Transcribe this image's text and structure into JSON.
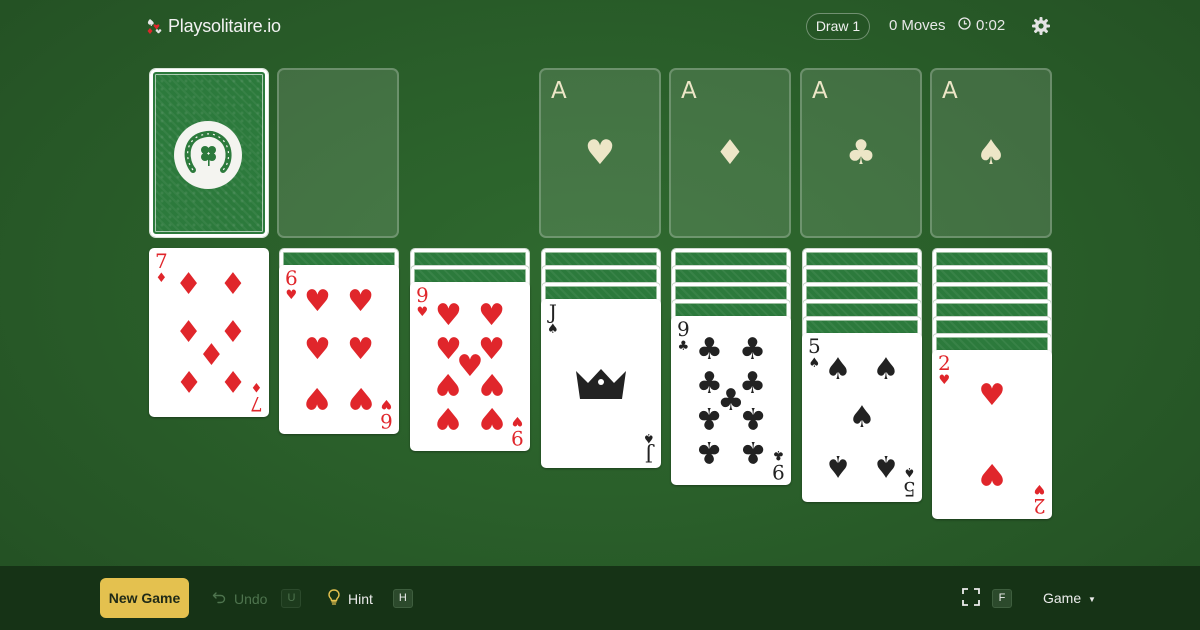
{
  "header": {
    "logo_text": "Playsolitaire.io",
    "draw_label": "Draw 1",
    "moves_count": "0",
    "moves_label": "Moves",
    "timer": "0:02"
  },
  "foundations": [
    {
      "rank": "A",
      "suit": "♥",
      "suit_name": "hearts"
    },
    {
      "rank": "A",
      "suit": "♦",
      "suit_name": "diamonds"
    },
    {
      "rank": "A",
      "suit": "♣",
      "suit_name": "clubs"
    },
    {
      "rank": "A",
      "suit": "♠",
      "suit_name": "spades"
    }
  ],
  "tableau": [
    {
      "face_down": 0,
      "top": {
        "rank": "7",
        "suit": "♦",
        "color": "red"
      }
    },
    {
      "face_down": 1,
      "top": {
        "rank": "6",
        "suit": "♥",
        "color": "red"
      }
    },
    {
      "face_down": 2,
      "top": {
        "rank": "9",
        "suit": "♥",
        "color": "red"
      }
    },
    {
      "face_down": 3,
      "top": {
        "rank": "J",
        "suit": "♠",
        "color": "black"
      }
    },
    {
      "face_down": 4,
      "top": {
        "rank": "9",
        "suit": "♣",
        "color": "black"
      }
    },
    {
      "face_down": 5,
      "top": {
        "rank": "5",
        "suit": "♠",
        "color": "black"
      }
    },
    {
      "face_down": 6,
      "top": {
        "rank": "2",
        "suit": "♥",
        "color": "red"
      }
    }
  ],
  "toolbar": {
    "new_game_label": "New Game",
    "undo_label": "Undo",
    "undo_key": "U",
    "hint_label": "Hint",
    "hint_key": "H",
    "fullscreen_key": "F",
    "game_menu_label": "Game"
  },
  "colors": {
    "felt": "#2a5f2a",
    "bar": "#163316",
    "card_back": "#2c7a3c",
    "accent_button": "#e4c14f",
    "red_suit": "#e0262b"
  }
}
